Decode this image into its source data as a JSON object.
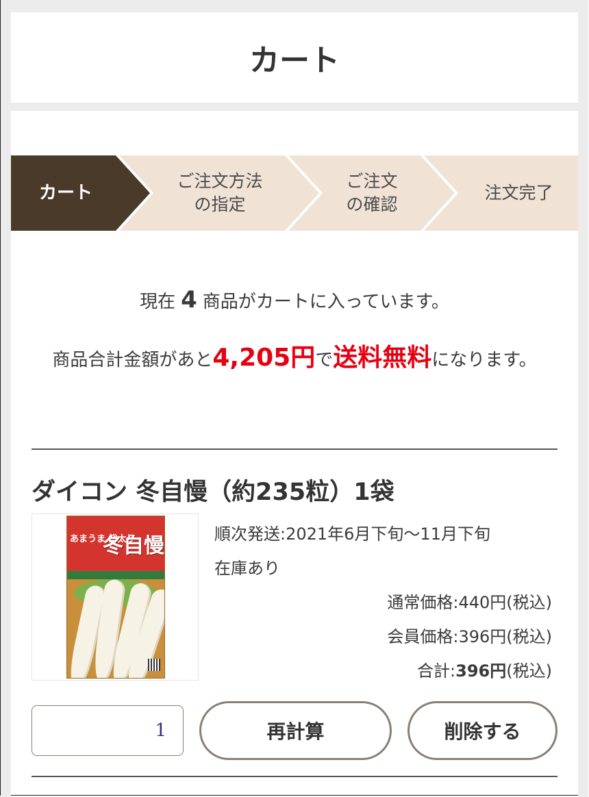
{
  "page": {
    "title": "カート"
  },
  "steps": [
    {
      "label": "カート",
      "state": "active"
    },
    {
      "label": "ご注文方法\nの指定",
      "state": "todo"
    },
    {
      "label": "ご注文\nの確認",
      "state": "todo"
    },
    {
      "label": "注文完了",
      "state": "todo"
    }
  ],
  "colors": {
    "step_active": "#4a3a2a",
    "step_todo": "#f1e2d6",
    "highlight_red": "#e60012",
    "button_border": "#8a7f74"
  },
  "summary": {
    "line1_prefix": "現在",
    "count": "4",
    "line1_suffix": "商品がカートに入っています。",
    "line2_prefix": "商品合計金額があと",
    "amount_left": "4,205円",
    "line2_mid": "で",
    "free_shipping": "送料無料",
    "line2_suffix": "になります。"
  },
  "item": {
    "name": "ダイコン 冬自慢（約235粒）1袋",
    "image_alt": "ダイコン 冬自慢 seed packet",
    "image_packet_text": {
      "brand": "あまうま 総太り",
      "title": "冬自慢"
    },
    "shipping": "順次発送:2021年6月下旬～11月下旬",
    "stock": "在庫あり",
    "regular_price": "通常価格:440円(税込)",
    "member_price": "会員価格:396円(税込)",
    "total_label": "合計:",
    "total_value": "396円",
    "total_tax": "(税込)",
    "quantity": "1",
    "recalc_label": "再計算",
    "delete_label": "削除する"
  }
}
